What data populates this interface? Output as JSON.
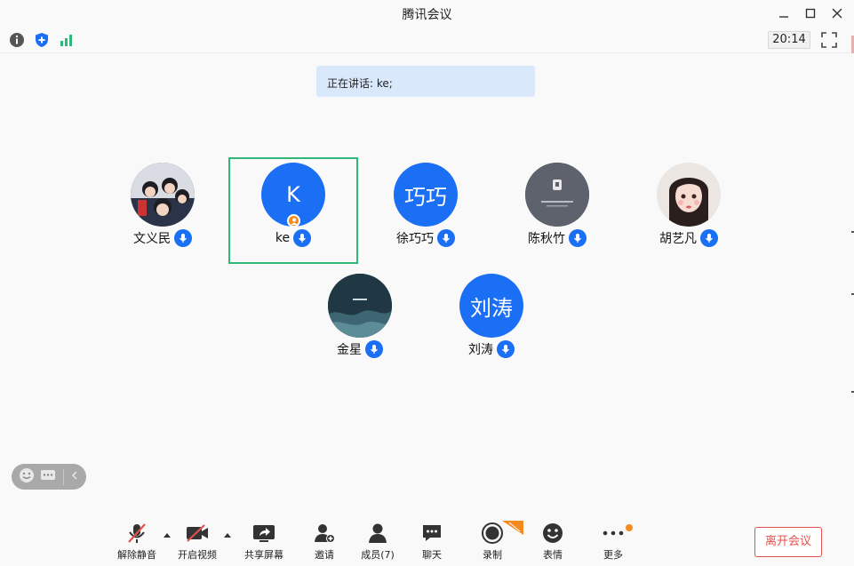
{
  "window": {
    "title": "腾讯会议"
  },
  "topbar": {
    "timer": "20:14"
  },
  "speaking": {
    "text": "正在讲话: ke;"
  },
  "participants": [
    {
      "name": "文义民",
      "avatar_type": "photo-group"
    },
    {
      "name": "ke",
      "initial": "K",
      "active": true,
      "host": true
    },
    {
      "name": "徐巧巧",
      "initial": "巧巧"
    },
    {
      "name": "陈秋竹",
      "avatar_type": "photo-dark"
    },
    {
      "name": "胡艺凡",
      "avatar_type": "photo-girl"
    },
    {
      "name": "金星",
      "avatar_type": "photo-sea"
    },
    {
      "name": "刘涛",
      "initial": "刘涛"
    }
  ],
  "toolbar": {
    "unmute": "解除静音",
    "start_video": "开启视频",
    "share_screen": "共享屏幕",
    "invite": "邀请",
    "members": "成员(7)",
    "chat": "聊天",
    "record": "录制",
    "emoji": "表情",
    "more": "更多",
    "leave": "离开会议"
  },
  "colors": {
    "accent": "#1b6ff5",
    "active_border": "#2fb879",
    "leave": "#e2524d",
    "badge": "#f58a1f"
  }
}
